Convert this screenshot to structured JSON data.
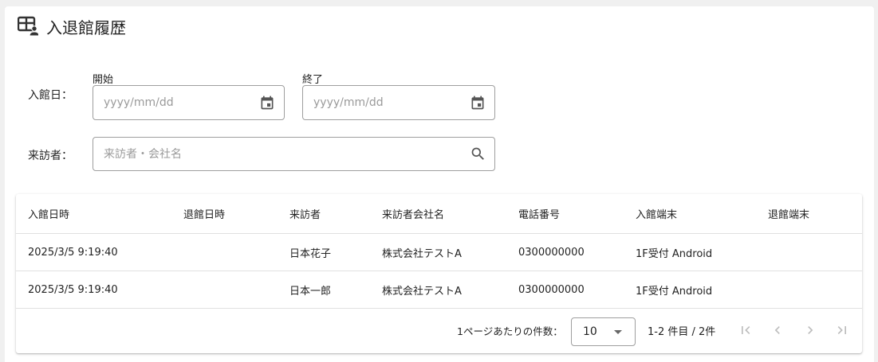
{
  "header": {
    "title": "入退館履歴",
    "icon": "visitor-table-icon"
  },
  "filters": {
    "entry_date_label": "入館日：",
    "start_label": "開始",
    "end_label": "終了",
    "start_placeholder": "yyyy/mm/dd",
    "end_placeholder": "yyyy/mm/dd",
    "start_value": "",
    "end_value": "",
    "visitor_label": "来訪者：",
    "visitor_placeholder": "来訪者・会社名",
    "visitor_value": ""
  },
  "table": {
    "columns": [
      "入館日時",
      "退館日時",
      "来訪者",
      "来訪者会社名",
      "電話番号",
      "入館端末",
      "退館端末"
    ],
    "rows": [
      [
        "2025/3/5 9:19:40",
        "",
        "日本花子",
        "株式会社テストA",
        "0300000000",
        "1F受付 Android",
        ""
      ],
      [
        "2025/3/5 9:19:40",
        "",
        "日本一郎",
        "株式会社テストA",
        "0300000000",
        "1F受付 Android",
        ""
      ]
    ]
  },
  "pagination": {
    "rows_per_page_label": "1ページあたりの件数：",
    "rows_per_page_value": "10",
    "range_text": "1-2 件目 / 2件"
  },
  "colors": {
    "border": "#9e9e9e",
    "divider": "#e0e0e0",
    "disabled_icon": "#bdbdbd",
    "text": "#222222"
  }
}
